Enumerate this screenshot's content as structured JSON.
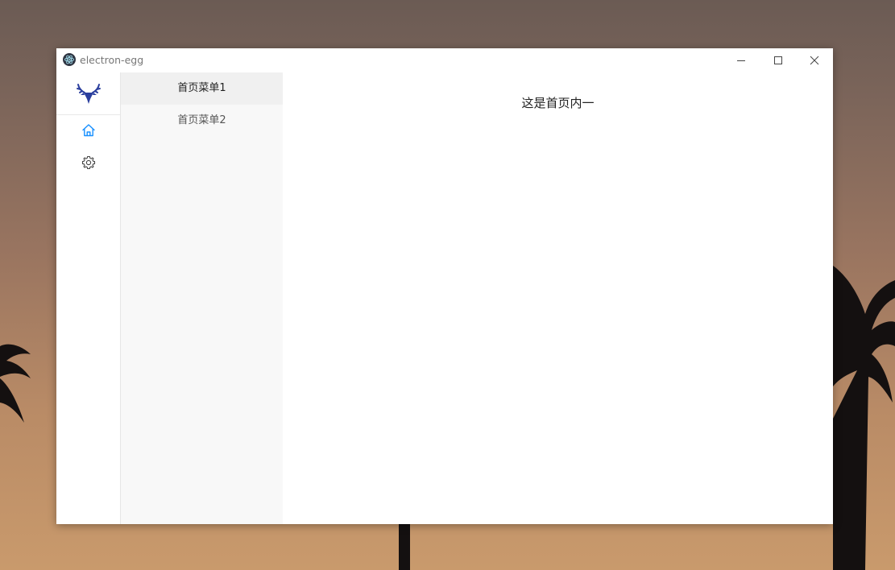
{
  "desktop": {
    "wallpaper": "sunset-palms"
  },
  "window": {
    "title": "electron-egg",
    "app_icon": "electron-icon",
    "controls": {
      "minimize_icon": "minimize-icon",
      "maximize_icon": "maximize-icon",
      "close_icon": "close-icon"
    }
  },
  "nav_rail": {
    "logo_icon": "deer-logo-icon",
    "items": [
      {
        "icon": "home-icon",
        "active": true
      },
      {
        "icon": "gear-icon",
        "active": false
      }
    ]
  },
  "submenu": {
    "items": [
      {
        "label": "首页菜单1",
        "active": true
      },
      {
        "label": "首页菜单2",
        "active": false
      }
    ]
  },
  "content": {
    "text": "这是首页内一"
  },
  "colors": {
    "accent": "#1890ff",
    "logo": "#2b3f9e",
    "submenu_bg": "#f8f8f8",
    "submenu_active_bg": "#f0f0f0"
  }
}
